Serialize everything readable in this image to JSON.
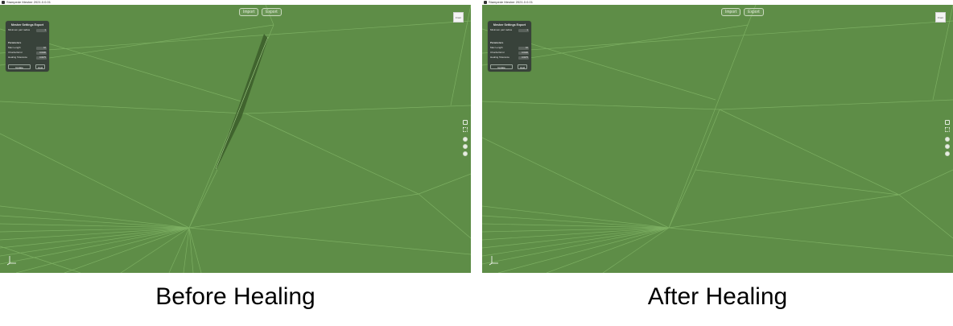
{
  "window": {
    "title": "Stampede Mesher 2021.0.0.01"
  },
  "toolbar": {
    "import_label": "Import",
    "export_label": "Export"
  },
  "viewcube": {
    "face_label": "Front"
  },
  "panel": {
    "title": "Mesher Settings Export",
    "min_part_radius_label": "Minimum part radius",
    "min_part_radius_value": "1",
    "parameters_label": "Parameters",
    "max_length_label": "Max Length",
    "max_length_value": "10",
    "chordal_error_label": "Chordal Error",
    "chordal_error_value": "0.0100",
    "healing_tolerance_label": "Healing Tolerance",
    "healing_tolerance_value": "0.0275",
    "update_label": "Update",
    "heal_label": "Heal"
  },
  "captions": {
    "before": "Before Healing",
    "after": "After Healing"
  },
  "colors": {
    "viewport_bg": "#5e8d47",
    "mesh_line": "#82b567",
    "defect": "#3d5f2b",
    "panel_bg": "#38423a"
  },
  "icons": [
    "app-icon",
    "view-cube-icon",
    "axis-triad-icon",
    "section-icon",
    "fit-icon",
    "orbit-icon",
    "pan-icon",
    "zoom-icon"
  ]
}
